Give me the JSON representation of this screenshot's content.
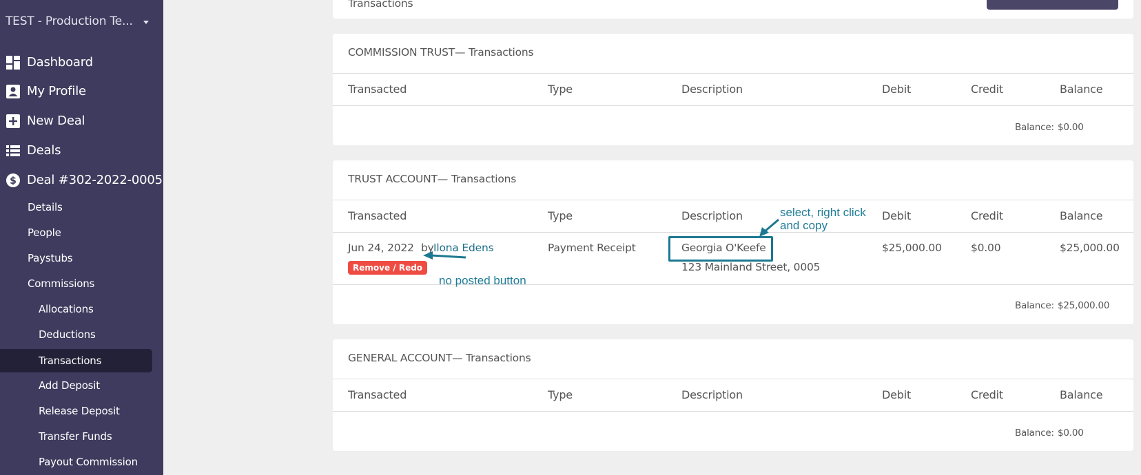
{
  "sidebar": {
    "org_name": "TEST - Production Te...",
    "main_items": [
      {
        "label": "Dashboard",
        "icon": "dashboard-icon"
      },
      {
        "label": "My Profile",
        "icon": "profile-icon"
      },
      {
        "label": "New Deal",
        "icon": "plus-square-icon"
      },
      {
        "label": "Deals",
        "icon": "list-icon"
      },
      {
        "label": "Deal #302-2022-0005",
        "icon": "dollar-circle-icon"
      }
    ],
    "deal_items": [
      "Details",
      "People",
      "Paystubs",
      "Commissions"
    ],
    "commission_items": [
      "Allocations",
      "Deductions",
      "Transactions",
      "Add Deposit",
      "Release Deposit",
      "Transfer Funds",
      "Payout Commission"
    ],
    "active": "Transactions"
  },
  "top_card": {
    "title": "Transactions",
    "button_label": ""
  },
  "columns": [
    "Transacted",
    "Type",
    "Description",
    "Debit",
    "Credit",
    "Balance"
  ],
  "accounts": [
    {
      "title": "COMMISSION TRUST— Transactions",
      "rows": [],
      "balance_label": "Balance:",
      "balance_value": "$0.00"
    },
    {
      "title": "TRUST ACCOUNT— Transactions",
      "rows": [
        {
          "date": "Jun 24, 2022",
          "by": "by",
          "user": "Ilona Edens",
          "action": "Remove / Redo",
          "type": "Payment Receipt",
          "description": "Georgia O'Keefe",
          "description_sub": "123 Mainland Street, 0005",
          "debit": "$25,000.00",
          "credit": "$0.00",
          "balance": "$25,000.00"
        }
      ],
      "balance_label": "Balance:",
      "balance_value": "$25,000.00"
    },
    {
      "title": "GENERAL ACCOUNT— Transactions",
      "rows": [],
      "balance_label": "Balance:",
      "balance_value": "$0.00"
    }
  ],
  "annotations": {
    "copy_hint_line1": "select, right click",
    "copy_hint_line2": "and copy",
    "posted_hint": "no posted button"
  },
  "colors": {
    "sidebar_bg": "#3f3b5e",
    "sidebar_active": "#232137",
    "danger": "#ee4c43",
    "link": "#1f6f8b",
    "annotation": "#1f7c99",
    "page_bg": "#efefef"
  }
}
